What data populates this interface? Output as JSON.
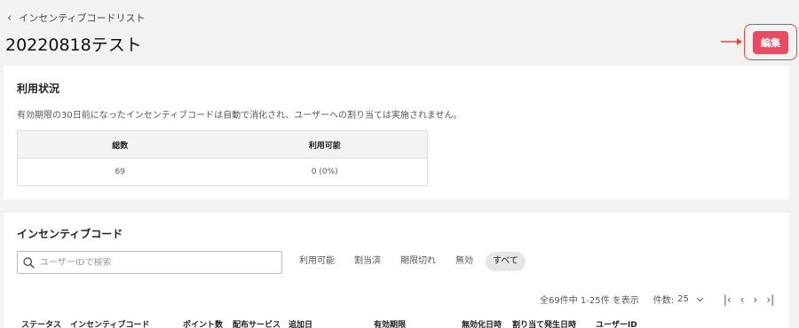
{
  "breadcrumb": {
    "label": "インセンティブコードリスト"
  },
  "page": {
    "title": "20220818テスト"
  },
  "header": {
    "edit_label": "編集"
  },
  "usage": {
    "title": "利用状況",
    "notice": "有効期限の30日前になったインセンティブコードは自動で消化され、ユーザーへの割り当ては実施されません。",
    "columns": [
      "総数",
      "利用可能"
    ],
    "values": [
      "69",
      "0 (0%)"
    ]
  },
  "codes": {
    "title": "インセンティブコード",
    "search_placeholder": "ユーザーIDで検索",
    "filters": [
      "利用可能",
      "割当済",
      "期限切れ",
      "無効",
      "すべて"
    ],
    "active_filter": "すべて",
    "summary": "全69件中 1-25件 を表示",
    "per_page_label": "件数:",
    "per_page_value": "25",
    "columns": [
      "ステータス",
      "インセンティブコード",
      "ポイント数",
      "配布サービス",
      "追加日",
      "有効期限",
      "無効化日時",
      "割り当て発生日時",
      "ユーザーID"
    ]
  },
  "colors": {
    "accent": "#e64c62",
    "annotation": "#e0473a"
  }
}
